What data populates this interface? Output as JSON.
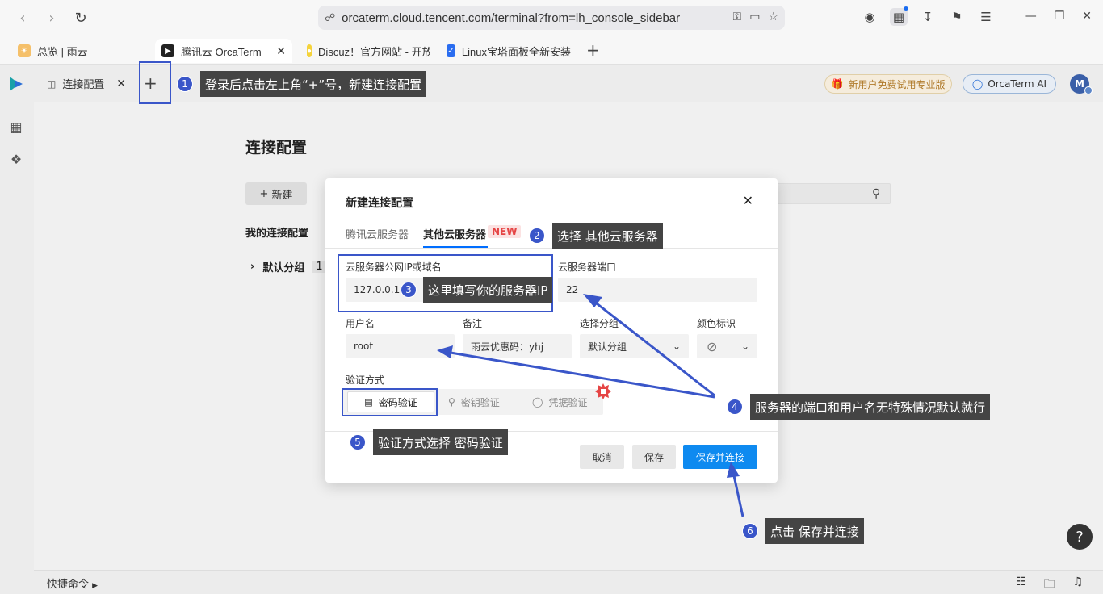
{
  "browser": {
    "url": "orcaterm.cloud.tencent.com/terminal?from=lh_console_sidebar",
    "tabs": [
      {
        "label": "总览 | 雨云"
      },
      {
        "label": "腾讯云 OrcaTerm"
      },
      {
        "label": "Discuz！官方网站 - 开放"
      },
      {
        "label": "Linux宝塔面板全新安装"
      }
    ]
  },
  "app": {
    "tab_label": "连接配置",
    "promo_label": "新用户免费试用专业版",
    "ai_label": "OrcaTerm AI",
    "avatar_initial": "M"
  },
  "page": {
    "title": "连接配置",
    "new_button": "新建",
    "my_connections": "我的连接配置",
    "default_group": "默认分组",
    "group_count": "1",
    "quick_cmd": "快捷命令"
  },
  "modal": {
    "title": "新建连接配置",
    "tab_tencent": "腾讯云服务器",
    "tab_other": "其他云服务器",
    "new_badge": "NEW",
    "ip_label": "云服务器公网IP或域名",
    "ip_value": "127.0.0.1",
    "port_label": "云服务器端口",
    "port_value": "22",
    "user_label": "用户名",
    "user_value": "root",
    "note_label": "备注",
    "note_value": "雨云优惠码：yhj",
    "group_label": "选择分组",
    "group_value": "默认分组",
    "color_label": "颜色标识",
    "auth_label": "验证方式",
    "auth_password": "密码验证",
    "auth_key": "密钥验证",
    "auth_credential": "凭据验证",
    "cancel": "取消",
    "save": "保存",
    "save_connect": "保存并连接"
  },
  "annotations": [
    {
      "num": "1",
      "text": "登录后点击左上角“+”号，新建连接配置"
    },
    {
      "num": "2",
      "text": "选择 其他云服务器"
    },
    {
      "num": "3",
      "text": "这里填写你的服务器IP"
    },
    {
      "num": "4",
      "text": "服务器的端口和用户名无特殊情况默认就行"
    },
    {
      "num": "5",
      "text": "验证方式选择 密码验证"
    },
    {
      "num": "6",
      "text": "点击 保存并连接"
    }
  ],
  "colors": {
    "accent": "#3a56c9",
    "primary": "#0e8af0"
  }
}
